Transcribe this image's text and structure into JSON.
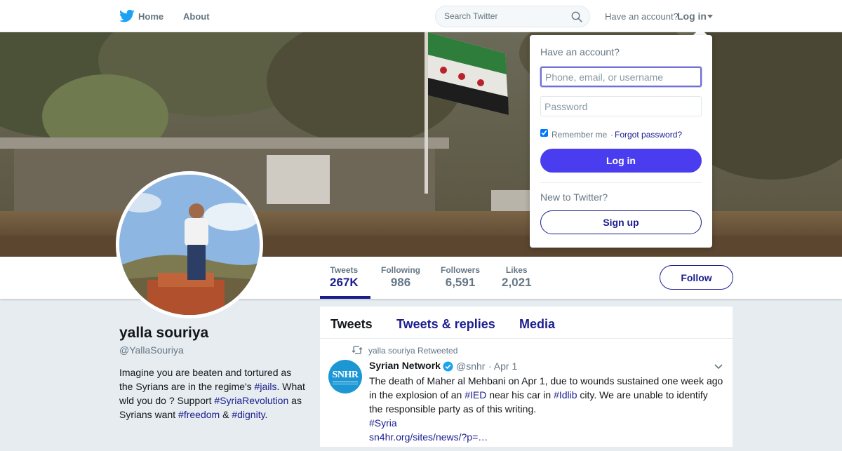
{
  "nav": {
    "logo_icon": "twitter-bird-icon",
    "home_label": "Home",
    "about_label": "About",
    "search_placeholder": "Search Twitter",
    "have_account": "Have an account?",
    "login_label": "Log in"
  },
  "profile": {
    "name": "yalla souriya",
    "handle": "@YallaSouriya",
    "bio": {
      "p1": "Imagine you are beaten and tortured as the Syrians are in the regime's ",
      "h1": "#jails",
      "p2": ". What wld you do ? Support ",
      "h2": "#SyriaRevolution",
      "p3": " as Syrians want ",
      "h3": "#freedom",
      "p4": " & ",
      "h4": "#dignity",
      "p5": "."
    },
    "follow_label": "Follow"
  },
  "stats": [
    {
      "label": "Tweets",
      "value": "267K"
    },
    {
      "label": "Following",
      "value": "986"
    },
    {
      "label": "Followers",
      "value": "6,591"
    },
    {
      "label": "Likes",
      "value": "2,021"
    }
  ],
  "timeline": {
    "tabs": [
      "Tweets",
      "Tweets & replies",
      "Media"
    ],
    "tweet": {
      "retweet_text": "yalla souriya Retweeted",
      "avatar_text": "SNHR",
      "author": "Syrian Network",
      "handle": "@snhr",
      "date": "· Apr 1",
      "text": {
        "t1": "The death of Maher al Mehbani on Apr 1, due to wounds sustained one week ago in the explosion of an ",
        "l1": "#IED",
        "t2": " near his car in ",
        "l2": "#Idlib",
        "t3": " city. We are unable to identify the responsible party as of this writing.",
        "l3": "#Syria",
        "l4": "sn4hr.org/sites/news/?p=…"
      }
    }
  },
  "login_dropdown": {
    "title": "Have an account?",
    "username_placeholder": "Phone, email, or username",
    "password_placeholder": "Password",
    "remember_label": "Remember me",
    "separator": "·",
    "forgot_label": "Forgot password?",
    "login_button": "Log in",
    "new_label": "New to Twitter?",
    "signup_button": "Sign up"
  },
  "colors": {
    "accent": "#1b1d8f",
    "login_button": "#4a3df0",
    "twitter_blue": "#1da1f2"
  }
}
